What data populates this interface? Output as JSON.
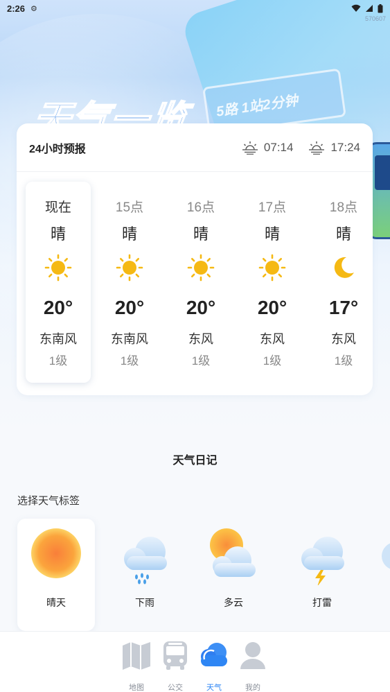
{
  "status_bar": {
    "time": "2:26",
    "id_text": "570607"
  },
  "banner": {
    "title": "天气一览",
    "sign_text": "5路 1站2分钟"
  },
  "forecast": {
    "title": "24小时预报",
    "sunrise": "07:14",
    "sunset": "17:24",
    "hours": [
      {
        "label": "现在",
        "condition": "晴",
        "icon": "sun-icon",
        "temp": "20°",
        "wind": "东南风",
        "level": "1级"
      },
      {
        "label": "15点",
        "condition": "晴",
        "icon": "sun-icon",
        "temp": "20°",
        "wind": "东南风",
        "level": "1级"
      },
      {
        "label": "16点",
        "condition": "晴",
        "icon": "sun-icon",
        "temp": "20°",
        "wind": "东风",
        "level": "1级"
      },
      {
        "label": "17点",
        "condition": "晴",
        "icon": "sun-icon",
        "temp": "20°",
        "wind": "东风",
        "level": "1级"
      },
      {
        "label": "18点",
        "condition": "晴",
        "icon": "moon-icon",
        "temp": "17°",
        "wind": "东风",
        "level": "1级"
      }
    ]
  },
  "diary": {
    "title": "天气日记",
    "select_label": "选择天气标签",
    "tags": [
      {
        "name": "晴天",
        "icon": "sunny-tag-icon"
      },
      {
        "name": "下雨",
        "icon": "rain-tag-icon"
      },
      {
        "name": "多云",
        "icon": "cloudy-tag-icon"
      },
      {
        "name": "打雷",
        "icon": "thunder-tag-icon"
      }
    ]
  },
  "nav": {
    "items": [
      {
        "label": "地图",
        "icon": "map-icon"
      },
      {
        "label": "公交",
        "icon": "bus-icon"
      },
      {
        "label": "天气",
        "icon": "weather-icon",
        "active": true
      },
      {
        "label": "我的",
        "icon": "profile-icon"
      }
    ]
  },
  "colors": {
    "accent": "#2f86f4",
    "sun": "#f5b914",
    "title_blue": "#2f7fe6"
  }
}
